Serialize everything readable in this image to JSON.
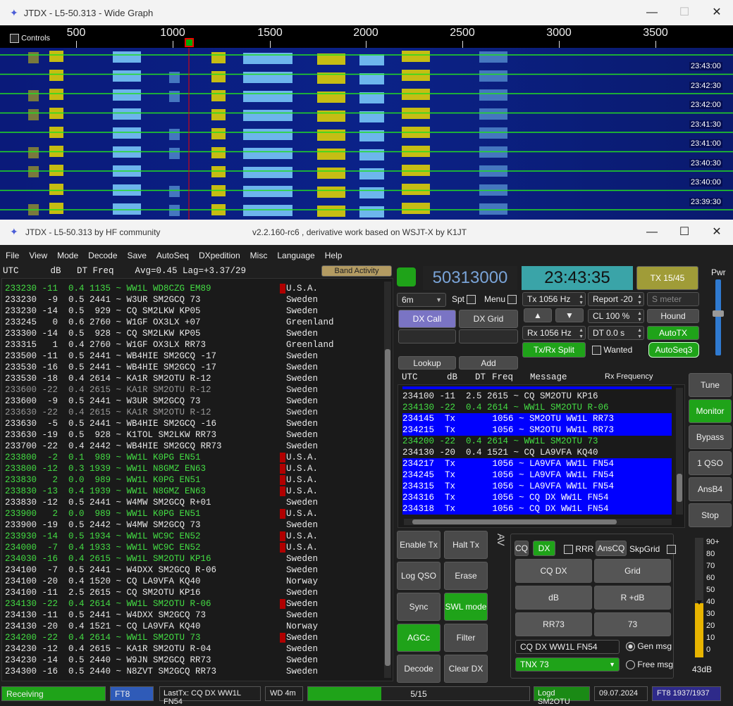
{
  "wide_graph": {
    "title": "JTDX - L5-50.313 - Wide Graph",
    "controls_label": "Controls",
    "freq_ticks": [
      "500",
      "1000",
      "1500",
      "2000",
      "2500",
      "3000",
      "3500"
    ],
    "timestamps": [
      "23:43:00",
      "23:42:30",
      "23:42:00",
      "23:41:30",
      "23:41:00",
      "23:40:30",
      "23:40:00",
      "23:39:30"
    ]
  },
  "main_window": {
    "title": "JTDX - L5-50.313  by HF community",
    "subtitle": "v2.2.160-rc6 , derivative work based on WSJT-X by K1JT",
    "menu": [
      "File",
      "View",
      "Mode",
      "Decode",
      "Save",
      "AutoSeq",
      "DXpedition",
      "Misc",
      "Language",
      "Help"
    ]
  },
  "band_activity": {
    "header": "UTC      dB   DT Freq    Avg=0.45 Lag=+3.37/29",
    "button": "Band Activity",
    "rows": [
      {
        "text": "233230 -11  0.4 1135 ~ WW1L WD8CZG EM89",
        "c": "g",
        "country": "U.S.A.",
        "m": "r"
      },
      {
        "text": "233230  -9  0.5 2441 ~ W3UR SM2GCQ 73",
        "c": "w",
        "country": "Sweden",
        "m": "n"
      },
      {
        "text": "233230 -14  0.5  929 ~ CQ SM2LKW KP05",
        "c": "w",
        "country": "Sweden",
        "m": "n"
      },
      {
        "text": "233245   0  0.6 2760 ~ W1GF OX3LX +07",
        "c": "w",
        "country": "Greenland",
        "m": "n"
      },
      {
        "text": "233300 -14  0.5  928 ~ CQ SM2LKW KP05",
        "c": "w",
        "country": "Sweden",
        "m": "n"
      },
      {
        "text": "233315   1  0.4 2760 ~ W1GF OX3LX RR73",
        "c": "w",
        "country": "Greenland",
        "m": "n"
      },
      {
        "text": "233500 -11  0.5 2441 ~ WB4HIE SM2GCQ -17",
        "c": "w",
        "country": "Sweden",
        "m": "n"
      },
      {
        "text": "233530 -16  0.5 2441 ~ WB4HIE SM2GCQ -17",
        "c": "w",
        "country": "Sweden",
        "m": "n"
      },
      {
        "text": "233530 -18  0.4 2614 ~ KA1R SM2OTU R-12",
        "c": "w",
        "country": "Sweden",
        "m": "n"
      },
      {
        "text": "233600 -22  0.4 2615 ~ KA1R SM2OTU R-12",
        "c": "d",
        "country": "Sweden",
        "m": "n"
      },
      {
        "text": "233600  -9  0.5 2441 ~ W3UR SM2GCQ 73",
        "c": "w",
        "country": "Sweden",
        "m": "n"
      },
      {
        "text": "233630 -22  0.4 2615 ~ KA1R SM2OTU R-12",
        "c": "d",
        "country": "Sweden",
        "m": "n"
      },
      {
        "text": "233630  -5  0.5 2441 ~ WB4HIE SM2GCQ -16",
        "c": "w",
        "country": "Sweden",
        "m": "n"
      },
      {
        "text": "233630 -19  0.5  928 ~ K1TOL SM2LKW RR73",
        "c": "w",
        "country": "Sweden",
        "m": "n"
      },
      {
        "text": "233700 -22  0.4 2442 ~ WB4HIE SM2GCQ RR73",
        "c": "w",
        "country": "Sweden",
        "m": "n"
      },
      {
        "text": "233800  -2  0.1  989 ~ WW1L K0PG EN51",
        "c": "g",
        "country": "U.S.A.",
        "m": "r"
      },
      {
        "text": "233800 -12  0.3 1939 ~ WW1L N8GMZ EN63",
        "c": "g",
        "country": "U.S.A.",
        "m": "r"
      },
      {
        "text": "233830   2  0.0  989 ~ WW1L K0PG EN51",
        "c": "g",
        "country": "U.S.A.",
        "m": "r"
      },
      {
        "text": "233830 -13  0.4 1939 ~ WW1L N8GMZ EN63",
        "c": "g",
        "country": "U.S.A.",
        "m": "r"
      },
      {
        "text": "233830 -12  0.5 2441 ~ W4MW SM2GCQ R+01",
        "c": "w",
        "country": "Sweden",
        "m": "n"
      },
      {
        "text": "233900   2  0.0  989 ~ WW1L K0PG EN51",
        "c": "g",
        "country": "U.S.A.",
        "m": "r"
      },
      {
        "text": "233900 -19  0.5 2442 ~ W4MW SM2GCQ 73",
        "c": "w",
        "country": "Sweden",
        "m": "n"
      },
      {
        "text": "233930 -14  0.5 1934 ~ WW1L WC9C EN52",
        "c": "g",
        "country": "U.S.A.",
        "m": "r"
      },
      {
        "text": "234000  -7  0.4 1933 ~ WW1L WC9C EN52",
        "c": "g",
        "country": "U.S.A.",
        "m": "r"
      },
      {
        "text": "234030 -16  0.4 2615 ~ WW1L SM2OTU KP16",
        "c": "g",
        "country": "Sweden",
        "m": "n"
      },
      {
        "text": "234100  -7  0.5 2441 ~ W4DXX SM2GCQ R-06",
        "c": "w",
        "country": "Sweden",
        "m": "n"
      },
      {
        "text": "234100 -20  0.4 1520 ~ CQ LA9VFA KQ40",
        "c": "w",
        "country": "Norway",
        "m": "n"
      },
      {
        "text": "234100 -11  2.5 2615 ~ CQ SM2OTU KP16",
        "c": "w",
        "country": "Sweden",
        "m": "n"
      },
      {
        "text": "234130 -22  0.4 2614 ~ WW1L SM2OTU R-06",
        "c": "g",
        "country": "Sweden",
        "m": "r"
      },
      {
        "text": "234130 -11  0.5 2441 ~ W4DXX SM2GCQ 73",
        "c": "w",
        "country": "Sweden",
        "m": "n"
      },
      {
        "text": "234130 -20  0.4 1521 ~ CQ LA9VFA KQ40",
        "c": "w",
        "country": "Norway",
        "m": "n"
      },
      {
        "text": "234200 -22  0.4 2614 ~ WW1L SM2OTU 73",
        "c": "g",
        "country": "Sweden",
        "m": "r"
      },
      {
        "text": "234230 -12  0.4 2615 ~ KA1R SM2OTU R-04",
        "c": "w",
        "country": "Sweden",
        "m": "n"
      },
      {
        "text": "234230 -14  0.5 2440 ~ W9JN SM2GCQ RR73",
        "c": "w",
        "country": "Sweden",
        "m": "n"
      },
      {
        "text": "234300 -16  0.5 2440 ~ N8ZVT SM2GCQ RR73",
        "c": "w",
        "country": "Sweden",
        "m": "n"
      }
    ]
  },
  "controls": {
    "frequency": "50313000",
    "clock": "23:43:35",
    "tx_slot": "TX 15/45",
    "pwr_label": "Pwr",
    "band": "6m",
    "spt_label": "Spt",
    "menu_label": "Menu",
    "tx_freq": "Tx  1056  Hz",
    "rx_freq": "Rx  1056  Hz",
    "report": "Report -20",
    "smeter_placeholder": "S meter",
    "cl": "CL  100 %",
    "dt": "DT 0.0 s",
    "dx_call": "DX Call",
    "dx_grid": "DX Grid",
    "hound": "Hound",
    "autotx": "AutoTX",
    "txrx_split": "Tx/Rx Split",
    "wanted": "Wanted",
    "autoseq3": "AutoSeq3",
    "lookup": "Lookup",
    "add": "Add"
  },
  "rx_freq_window": {
    "headers": [
      "UTC",
      "dB",
      "DT",
      "Freq",
      "Message",
      "Rx Frequency"
    ],
    "rows": [
      {
        "text": "234100 -11  2.5 2615 ~ CQ SM2OTU KP16",
        "c": "w"
      },
      {
        "text": "234130 -22  0.4 2614 ~ WW1L SM2OTU R-06",
        "c": "g"
      },
      {
        "text": "234145  Tx       1056 ~ SM2OTU WW1L RR73",
        "c": "b"
      },
      {
        "text": "234215  Tx       1056 ~ SM2OTU WW1L RR73",
        "c": "b"
      },
      {
        "text": "234200 -22  0.4 2614 ~ WW1L SM2OTU 73",
        "c": "g"
      },
      {
        "text": "234130 -20  0.4 1521 ~ CQ LA9VFA KQ40",
        "c": "w"
      },
      {
        "text": "234217  Tx       1056 ~ LA9VFA WW1L FN54",
        "c": "b"
      },
      {
        "text": "234245  Tx       1056 ~ LA9VFA WW1L FN54",
        "c": "b"
      },
      {
        "text": "234315  Tx       1056 ~ LA9VFA WW1L FN54",
        "c": "b"
      },
      {
        "text": "234316  Tx       1056 ~ CQ DX WW1L FN54",
        "c": "b"
      },
      {
        "text": "234318  Tx       1056 ~ CQ DX WW1L FN54",
        "c": "b"
      }
    ]
  },
  "side_buttons": [
    "Tune",
    "Monitor",
    "Bypass",
    "1 QSO",
    "AnsB4",
    "Stop"
  ],
  "bottom_buttons": {
    "enable_tx": "Enable Tx",
    "halt_tx": "Halt Tx",
    "log_qso": "Log QSO",
    "erase": "Erase",
    "sync": "Sync",
    "swl_mode": "SWL mode",
    "agcc": "AGCc",
    "filter": "Filter",
    "decode": "Decode",
    "clear_dx": "Clear DX",
    "arrows": "AV"
  },
  "tx_panel": {
    "cq": "CQ",
    "dx": "DX",
    "rrr": "RRR",
    "anscq": "AnsCQ",
    "skpgrid": "SkpGrid",
    "cq_dx": "CQ DX",
    "grid": "Grid",
    "db": "dB",
    "r_db": "R +dB",
    "rr73": "RR73",
    "n73": "73",
    "message": "CQ DX WW1L FN54",
    "gen_msg": "Gen msg",
    "tnx73": "TNX 73",
    "free_msg": "Free msg"
  },
  "meter": {
    "scale": [
      "90+",
      "80",
      "70",
      "60",
      "50",
      "40",
      "30",
      "20",
      "10",
      "0"
    ],
    "reading": "43dB",
    "level_db": 43
  },
  "status_bar": {
    "receiving": "Receiving",
    "mode": "FT8",
    "last_tx": "LastTx: CQ DX WW1L FN54",
    "wd": "WD 4m",
    "progress": "5/15",
    "progress_fraction": 0.33,
    "logged": "Logd SM2OTU",
    "date": "09.07.2024",
    "mode_count": "FT8  1937/1937"
  }
}
